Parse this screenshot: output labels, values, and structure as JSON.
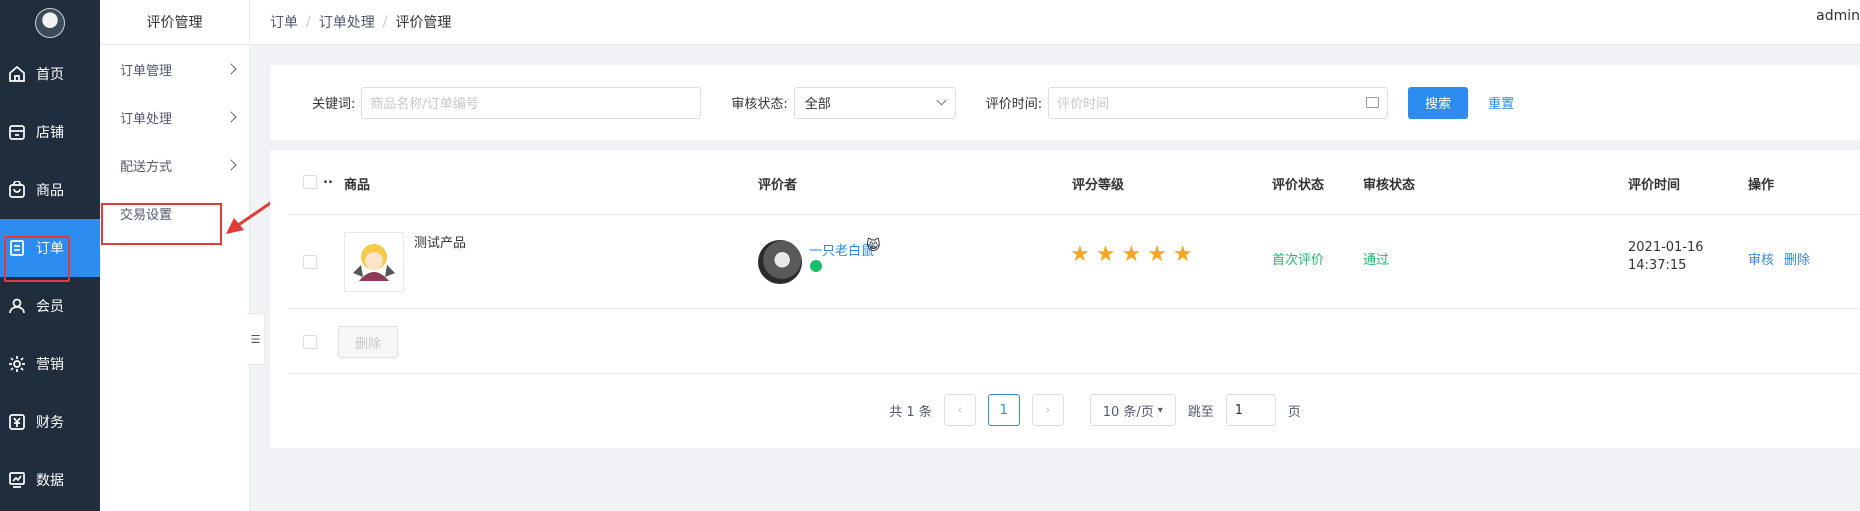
{
  "nav": {
    "items": [
      {
        "label": "首页",
        "icon": "home-icon"
      },
      {
        "label": "店铺",
        "icon": "store-icon"
      },
      {
        "label": "商品",
        "icon": "product-icon"
      },
      {
        "label": "订单",
        "icon": "order-icon",
        "active": true
      },
      {
        "label": "会员",
        "icon": "user-icon"
      },
      {
        "label": "营销",
        "icon": "marketing-icon"
      },
      {
        "label": "财务",
        "icon": "finance-icon"
      },
      {
        "label": "数据",
        "icon": "data-icon"
      }
    ]
  },
  "subnav": {
    "title": "评价管理",
    "items": [
      {
        "label": "订单管理"
      },
      {
        "label": "订单处理"
      },
      {
        "label": "配送方式"
      },
      {
        "label": "交易设置"
      }
    ]
  },
  "breadcrumb": [
    "订单",
    "订单处理",
    "评价管理"
  ],
  "header": {
    "user": "admin"
  },
  "filter": {
    "keyword_label": "关键词:",
    "keyword_placeholder": "商品名称/订单编号",
    "status_label": "审核状态:",
    "status_value": "全部",
    "time_label": "评价时间:",
    "time_placeholder": "评价时间",
    "search_label": "搜索",
    "reset_label": "重置"
  },
  "table": {
    "columns": [
      "商品",
      "评价者",
      "评分等级",
      "评价状态",
      "审核状态",
      "评价时间",
      "操作"
    ],
    "rows": [
      {
        "product": "测试产品",
        "reviewer": "一只老白鼠",
        "rating": 5,
        "review_status": "首次评价",
        "audit_status": "通过",
        "date": "2021-01-16",
        "time": "14:37:15",
        "actions": [
          "审核",
          "删除"
        ]
      }
    ],
    "batch_delete": "删除"
  },
  "pagination": {
    "total": "共 1 条",
    "current": "1",
    "page_size": "10 条/页",
    "jump_label": "跳至",
    "jump_value": "1",
    "page_unit": "页"
  },
  "colors": {
    "primary": "#2d8cf0",
    "nav_bg": "#1f2d3d",
    "success": "#19be6b",
    "star": "#f5a623",
    "annotation": "#e53935"
  }
}
